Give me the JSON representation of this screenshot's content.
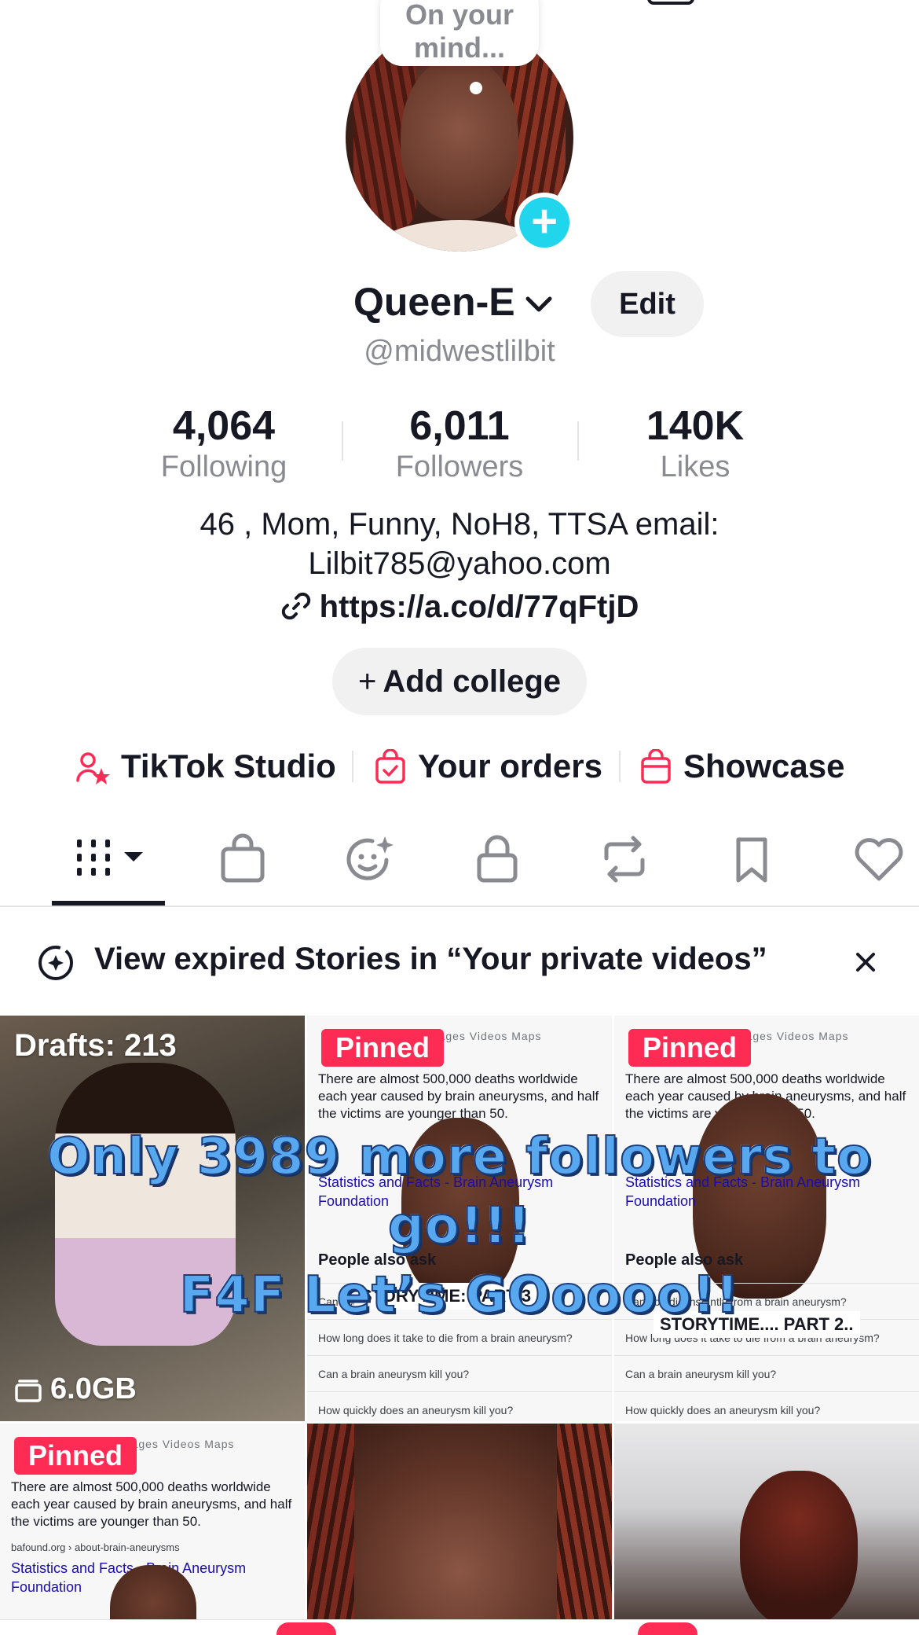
{
  "avatar_bubble": {
    "text": "On your\nmind..."
  },
  "profile": {
    "display_name": "Queen-E",
    "edit_label": "Edit",
    "handle": "@midwestlilbit",
    "bio_line1": "46 , Mom, Funny, NoH8, TTSA email:",
    "bio_line2": "Lilbit785@yahoo.com",
    "link": "https://a.co/d/77qFtjD",
    "add_college_label": "Add college"
  },
  "stats": [
    {
      "value": "4,064",
      "label": "Following"
    },
    {
      "value": "6,011",
      "label": "Followers"
    },
    {
      "value": "140K",
      "label": "Likes"
    }
  ],
  "shortcuts": {
    "studio": "TikTok Studio",
    "orders": "Your orders",
    "showcase": "Showcase"
  },
  "tabs": [
    "videos-grid-icon",
    "shop-bag-icon",
    "reposted-face-icon",
    "private-lock-icon",
    "repost-icon",
    "favorites-bookmark-icon",
    "liked-heart-icon"
  ],
  "banner": {
    "text": "View expired Stories in “Your private videos”"
  },
  "grid": {
    "drafts_label": "Drafts: 213",
    "drafts_size": "6.0GB",
    "pinned_label": "Pinned",
    "search_snippet": "There are almost 500,000 deaths worldwide each year caused by brain aneurysms, and half the victims are younger than 50.",
    "search_nav": "Images   Videos   Maps",
    "search_link_source": "bafound.org › about-brain-aneurysms",
    "search_link_title": "Statistics and Facts - Brain Aneurysm Foundation",
    "people_also": "People also ask",
    "q1": "Can you die instantly from a brain aneurysm?",
    "q2": "How long does it take to die from a brain aneurysm?",
    "q3": "Can a brain aneurysm kill you?",
    "q4": "How quickly does an aneurysm kill you?",
    "caption_part3": "STORYTIME: PART 3",
    "caption_part2": "STORYTIME.... PART 2..",
    "overlay_line1": "Only 3989 more followers to go!!!",
    "overlay_line2": "F4F Let’s GOoooo!!"
  },
  "colors": {
    "accent": "#fe2c55",
    "avatar_add": "#20d5ec",
    "overlay_text": "#58a8f0"
  }
}
